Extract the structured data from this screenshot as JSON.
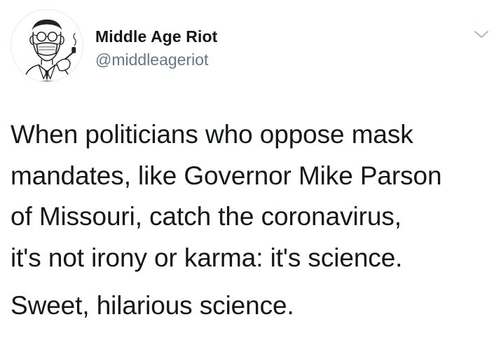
{
  "user": {
    "display_name": "Middle Age Riot",
    "handle": "@middleageriot",
    "avatar_icon": "man-in-mask-with-pipe-avatar"
  },
  "menu": {
    "icon": "chevron-down-icon"
  },
  "tweet": {
    "lines": [
      "When politicians who oppose mask",
      "mandates, like Governor Mike Parson",
      "of Missouri, catch the coronavirus,",
      "it's not irony or karma: it's science."
    ],
    "second_paragraph": "Sweet, hilarious science."
  },
  "colors": {
    "text": "#14171a",
    "secondary": "#657786",
    "chevron": "#aab8c2"
  }
}
